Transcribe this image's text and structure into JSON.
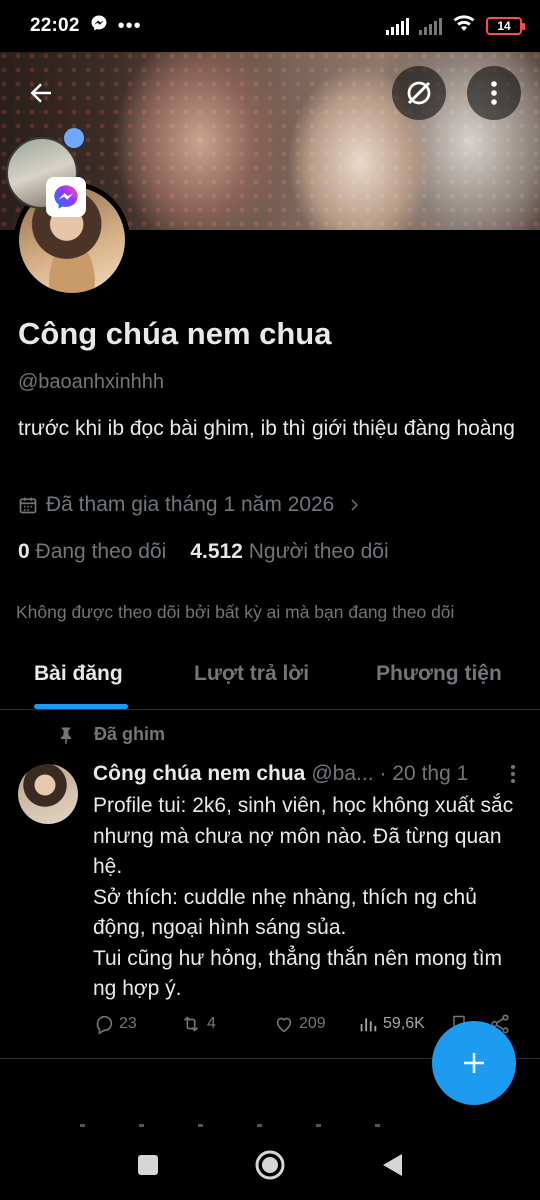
{
  "status_bar": {
    "time": "22:02",
    "battery": "14"
  },
  "profile": {
    "name": "Công chúa nem chua",
    "handle": "@baoanhxinhhh",
    "bio": "trước khi ib đọc bài ghim, ib thì giới thiệu đàng hoàng",
    "joined": "Đã tham gia tháng 1 năm 2026",
    "following_count": "0",
    "following_label": "Đang theo dõi",
    "followers_count": "4.512",
    "followers_label": "Người theo dõi",
    "not_followed_note": "Không được theo dõi bởi bất kỳ ai mà bạn đang theo dõi"
  },
  "tabs": [
    {
      "label": "Bài đăng",
      "active": true
    },
    {
      "label": "Lượt trả lời",
      "active": false
    },
    {
      "label": "Phương tiện",
      "active": false
    }
  ],
  "post": {
    "pinned_label": "Đã ghim",
    "author_name": "Công chúa nem chua",
    "author_handle": "@ba...",
    "date": "· 20 thg 1",
    "lines": [
      "Profile tui: 2k6, sinh viên, học không xuất sắc nhưng mà chưa nợ môn nào. Đã từng quan hệ.",
      "Sở thích: cuddle nhẹ nhàng, thích ng chủ động, ngoại hình sáng sủa.",
      "Tui cũng hư hỏng, thẳng thắn nên mong tìm ng hợp ý."
    ],
    "replies": "23",
    "reposts": "4",
    "likes": "209",
    "views": "59,6K"
  },
  "colors": {
    "accent": "#1d9bf0",
    "muted": "#71767b",
    "text": "#e7e9ea",
    "background": "#000000"
  }
}
